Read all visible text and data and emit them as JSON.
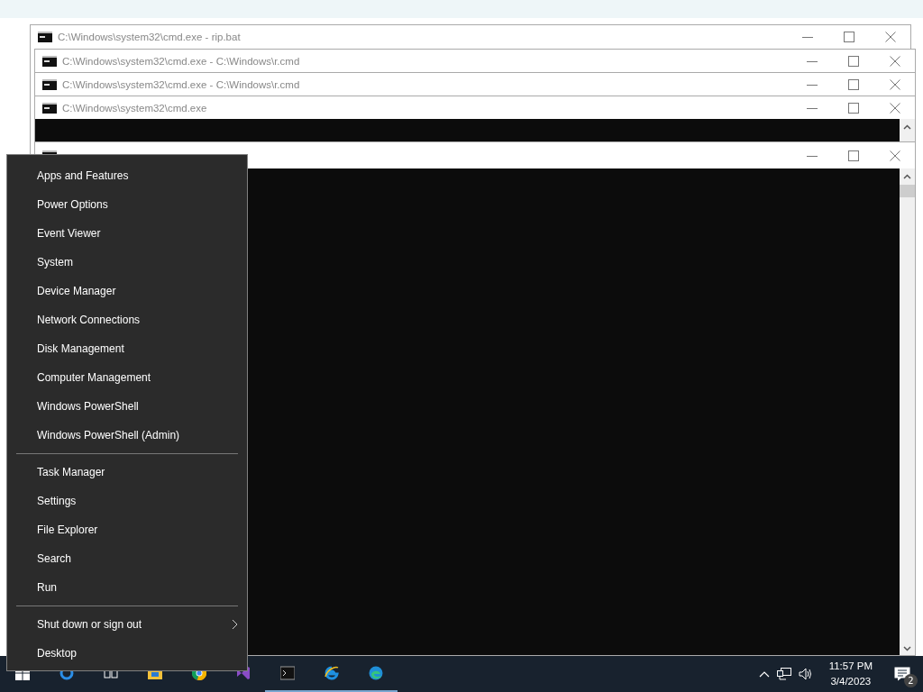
{
  "windows": [
    {
      "title": "C:\\Windows\\system32\\cmd.exe - rip.bat"
    },
    {
      "title": "C:\\Windows\\system32\\cmd.exe - C:\\Windows\\r.cmd"
    },
    {
      "title": "C:\\Windows\\system32\\cmd.exe - C:\\Windows\\r.cmd"
    },
    {
      "title": "C:\\Windows\\system32\\cmd.exe",
      "console": true
    },
    {
      "console": true
    }
  ],
  "context_menu": {
    "groups": [
      [
        {
          "label": "Apps and Features"
        },
        {
          "label": "Power Options"
        },
        {
          "label": "Event Viewer"
        },
        {
          "label": "System"
        },
        {
          "label": "Device Manager"
        },
        {
          "label": "Network Connections"
        },
        {
          "label": "Disk Management"
        },
        {
          "label": "Computer Management"
        },
        {
          "label": "Windows PowerShell"
        },
        {
          "label": "Windows PowerShell (Admin)"
        }
      ],
      [
        {
          "label": "Task Manager"
        },
        {
          "label": "Settings"
        },
        {
          "label": "File Explorer"
        },
        {
          "label": "Search"
        },
        {
          "label": "Run"
        }
      ],
      [
        {
          "label": "Shut down or sign out",
          "submenu": true
        },
        {
          "label": "Desktop"
        }
      ]
    ]
  },
  "taskbar": {
    "apps": [
      {
        "kind": "start",
        "running": false
      },
      {
        "kind": "search",
        "running": false
      },
      {
        "kind": "taskview",
        "running": false
      },
      {
        "kind": "explorer",
        "running": false
      },
      {
        "kind": "chrome",
        "running": false
      },
      {
        "kind": "studio",
        "running": false
      },
      {
        "kind": "console",
        "running": true
      },
      {
        "kind": "ie",
        "running": true
      },
      {
        "kind": "edge",
        "running": true
      }
    ],
    "time": "11:57 PM",
    "date": "3/4/2023",
    "notifications": "2"
  }
}
